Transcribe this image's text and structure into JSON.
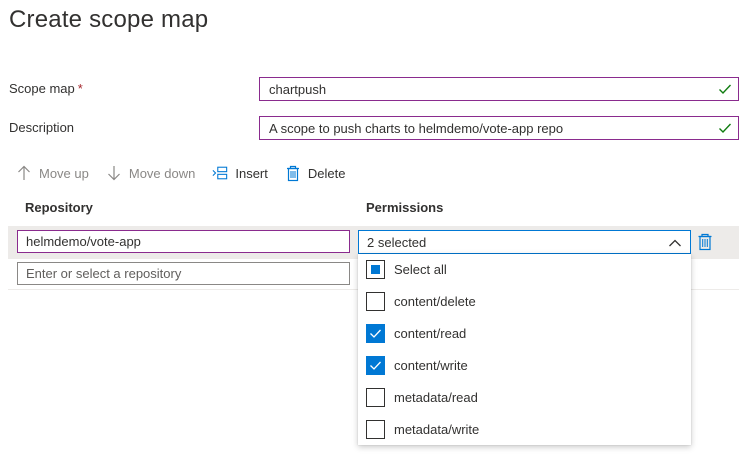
{
  "page": {
    "title": "Create scope map"
  },
  "form": {
    "scope_map": {
      "label": "Scope map",
      "required_mark": "*",
      "value": "chartpush"
    },
    "description": {
      "label": "Description",
      "value": "A scope to push charts to helmdemo/vote-app repo"
    }
  },
  "toolbar": {
    "move_up": "Move up",
    "move_down": "Move down",
    "insert": "Insert",
    "delete": "Delete"
  },
  "table": {
    "headers": {
      "repository": "Repository",
      "permissions": "Permissions"
    },
    "rows": [
      {
        "repository": "helmdemo/vote-app",
        "permissions_summary": "2 selected"
      }
    ],
    "new_row": {
      "placeholder": "Enter or select a repository"
    }
  },
  "permissions_dropdown": {
    "options": [
      {
        "label": "Select all",
        "state": "indeterminate"
      },
      {
        "label": "content/delete",
        "state": "unchecked"
      },
      {
        "label": "content/read",
        "state": "checked"
      },
      {
        "label": "content/write",
        "state": "checked"
      },
      {
        "label": "metadata/read",
        "state": "unchecked"
      },
      {
        "label": "metadata/write",
        "state": "unchecked"
      }
    ]
  },
  "colors": {
    "accent": "#0078d4",
    "field_border": "#8a2b8e",
    "valid_check": "#107c10",
    "required": "#a4262c"
  }
}
